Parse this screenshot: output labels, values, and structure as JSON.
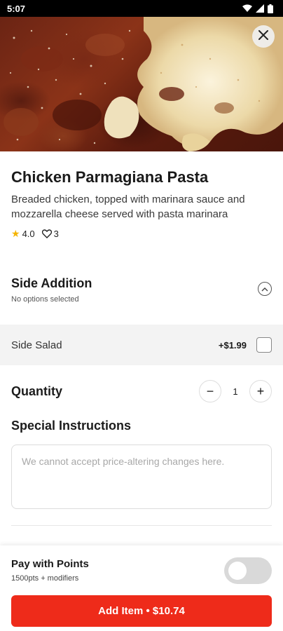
{
  "status_bar": {
    "time": "5:07",
    "icons": [
      "wifi-icon",
      "signal-icon",
      "battery-icon"
    ]
  },
  "item": {
    "title": "Chicken Parmagiana Pasta",
    "description": "Breaded chicken, topped with marinara sauce and mozzarella cheese served with pasta marinara",
    "rating": "4.0",
    "likes": "3"
  },
  "side_addition": {
    "title": "Side Addition",
    "subtitle": "No options selected",
    "options": [
      {
        "label": "Side Salad",
        "price": "+$1.99",
        "checked": false
      }
    ]
  },
  "quantity": {
    "label": "Quantity",
    "value": "1",
    "minus": "−",
    "plus": "+"
  },
  "special_instructions": {
    "title": "Special Instructions",
    "placeholder": "We cannot accept price-altering changes here."
  },
  "pay_with_points": {
    "title": "Pay with Points",
    "subtitle": "1500pts + modifiers",
    "enabled": false
  },
  "add_button": {
    "label": "Add Item • $10.74"
  },
  "colors": {
    "accent": "#ee2b1a",
    "star": "#f5b400",
    "toggle_off": "#d9d9d9"
  }
}
